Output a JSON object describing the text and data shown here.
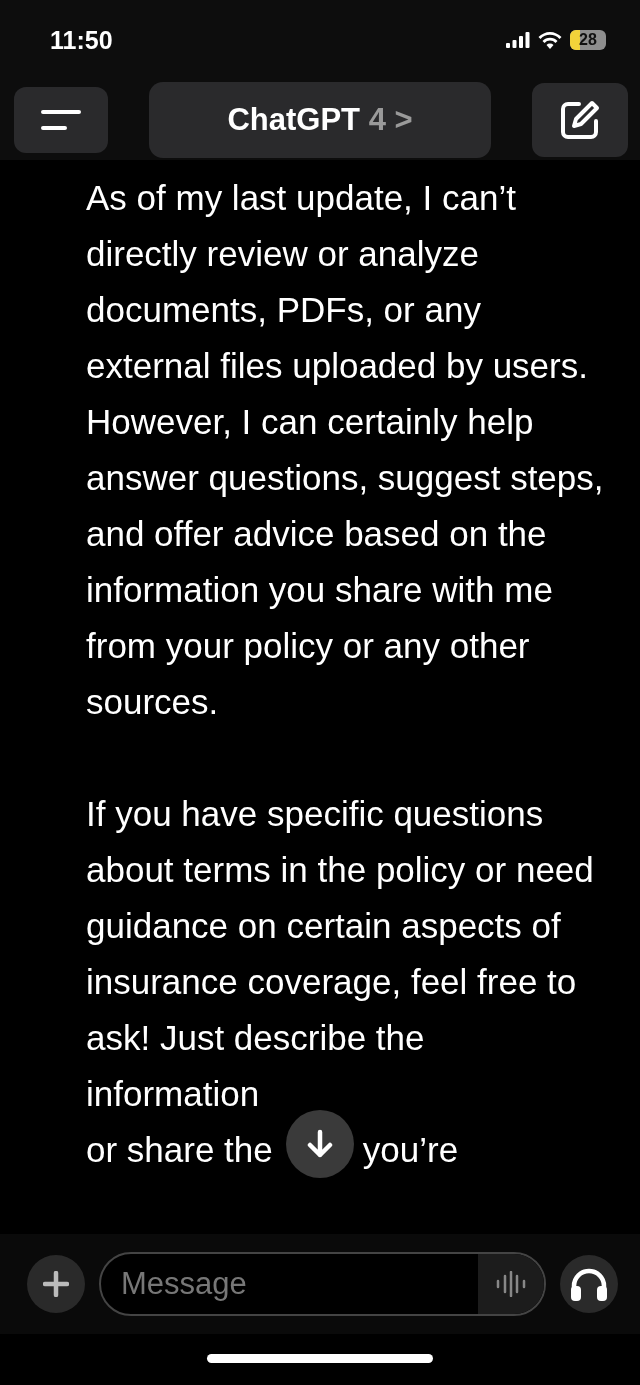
{
  "status_bar": {
    "time": "11:50",
    "battery": "28"
  },
  "header": {
    "title": "ChatGPT",
    "model": "4",
    "chevron": ">"
  },
  "message": {
    "paragraphs": [
      "As of my last update, I can’t directly review or analyze documents, PDFs, or any external files uploaded by users. However, I can certainly help answer questions, suggest steps, and offer advice based on the information you share with me from your policy or any other sources.",
      "If you have specific questions about terms in the policy or need guidance on certain aspects of insurance coverage, feel free to ask! Just describe the information"
    ],
    "covered_line": [
      "or share the",
      "you’re"
    ]
  },
  "composer": {
    "placeholder": "Message"
  }
}
